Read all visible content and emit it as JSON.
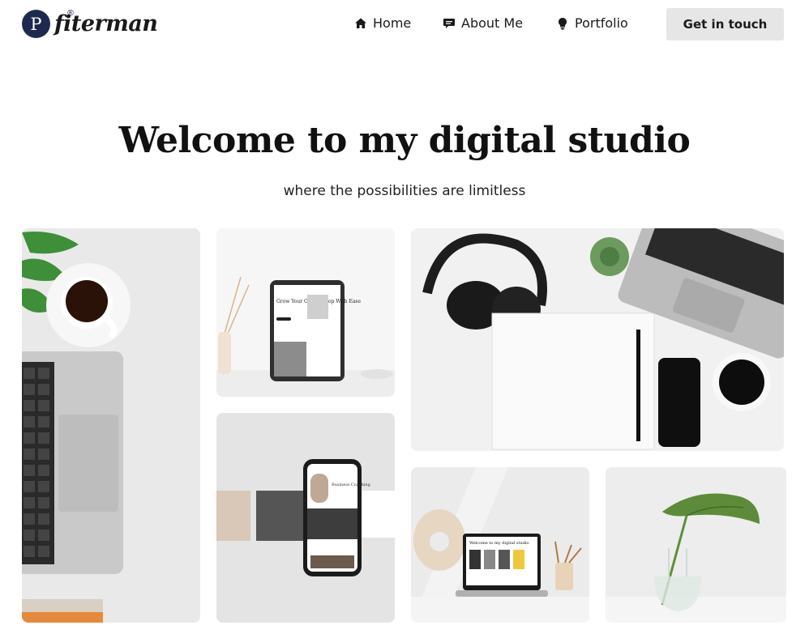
{
  "brand": {
    "logo_letter": "P",
    "registered_mark": "®",
    "name": "fiterman"
  },
  "nav": {
    "items": [
      {
        "label": "Home",
        "icon": "home-icon"
      },
      {
        "label": "About Me",
        "icon": "chat-bubble-icon"
      },
      {
        "label": "Portfolio",
        "icon": "lightbulb-icon"
      }
    ],
    "cta_label": "Get in touch"
  },
  "hero": {
    "title": "Welcome to my digital studio",
    "subtitle": "where the possibilities are limitless"
  },
  "gallery": {
    "images": [
      {
        "name": "desk-laptop-coffee-photo"
      },
      {
        "name": "tablet-mockup-photo",
        "tablet_headline": "Grow Your Online Shop With Ease"
      },
      {
        "name": "headphones-desk-photo"
      },
      {
        "name": "phone-mockup-photo",
        "phone_headline": "Business Coaching"
      },
      {
        "name": "laptop-mockup-photo",
        "laptop_headline": "Welcome to my digital studio"
      },
      {
        "name": "plant-vase-photo"
      }
    ]
  }
}
